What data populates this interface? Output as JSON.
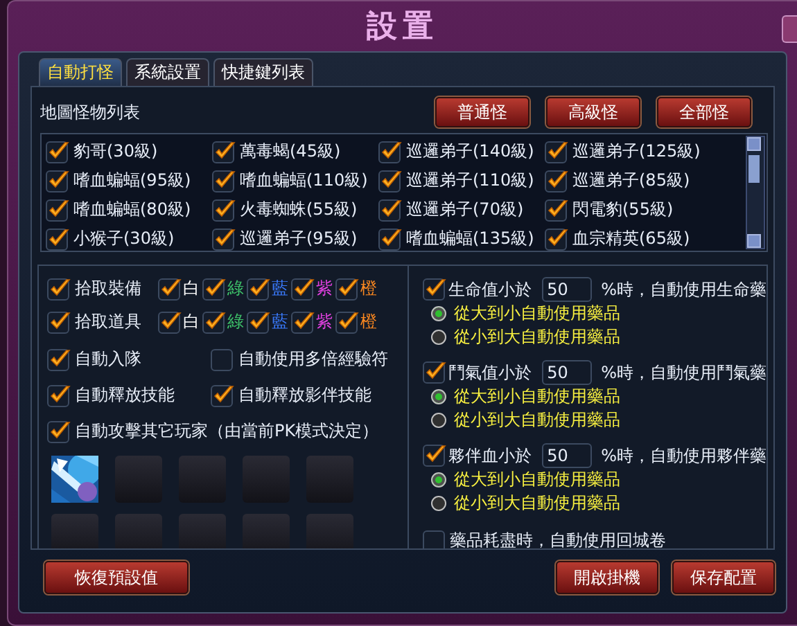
{
  "window": {
    "title": "設置"
  },
  "tabs": [
    {
      "label": "自動打怪",
      "selected": true
    },
    {
      "label": "系統設置",
      "selected": false
    },
    {
      "label": "快捷鍵列表",
      "selected": false
    }
  ],
  "monster_list": {
    "title": "地圖怪物列表",
    "buttons": [
      "普通怪",
      "高級怪",
      "全部怪"
    ],
    "items": [
      {
        "label": "豹哥(30級)",
        "checked": true
      },
      {
        "label": "萬毒蝎(45級)",
        "checked": true
      },
      {
        "label": "巡邏弟子(140級)",
        "checked": true
      },
      {
        "label": "巡邏弟子(125級)",
        "checked": true
      },
      {
        "label": "嗜血蝙蝠(95級)",
        "checked": true
      },
      {
        "label": "嗜血蝙蝠(110級)",
        "checked": true
      },
      {
        "label": "巡邏弟子(110級)",
        "checked": true
      },
      {
        "label": "巡邏弟子(85級)",
        "checked": true
      },
      {
        "label": "嗜血蝙蝠(80級)",
        "checked": true
      },
      {
        "label": "火毒蜘蛛(55級)",
        "checked": true
      },
      {
        "label": "巡邏弟子(70級)",
        "checked": true
      },
      {
        "label": "閃電豹(55級)",
        "checked": true
      },
      {
        "label": "小猴子(30級)",
        "checked": true
      },
      {
        "label": "巡邏弟子(95級)",
        "checked": true
      },
      {
        "label": "嗜血蝙蝠(135級)",
        "checked": true
      },
      {
        "label": "血宗精英(65級)",
        "checked": true
      }
    ]
  },
  "pickup": [
    {
      "label": "拾取裝備",
      "checked": true,
      "grades": [
        {
          "label": "白",
          "checked": true,
          "color": "#ffffff"
        },
        {
          "label": "綠",
          "checked": true,
          "color": "#3ec46a"
        },
        {
          "label": "藍",
          "checked": true,
          "color": "#3a7bff"
        },
        {
          "label": "紫",
          "checked": true,
          "color": "#e040e0"
        },
        {
          "label": "橙",
          "checked": true,
          "color": "#ff8a20"
        }
      ]
    },
    {
      "label": "拾取道具",
      "checked": true,
      "grades": [
        {
          "label": "白",
          "checked": true,
          "color": "#ffffff"
        },
        {
          "label": "綠",
          "checked": true,
          "color": "#3ec46a"
        },
        {
          "label": "藍",
          "checked": true,
          "color": "#3a7bff"
        },
        {
          "label": "紫",
          "checked": true,
          "color": "#e040e0"
        },
        {
          "label": "橙",
          "checked": true,
          "color": "#ff8a20"
        }
      ]
    }
  ],
  "options": [
    {
      "label": "自動入隊",
      "checked": true
    },
    {
      "label": "自動使用多倍經驗符",
      "checked": false
    },
    {
      "label": "自動釋放技能",
      "checked": true
    },
    {
      "label": "自動釋放影伴技能",
      "checked": true
    },
    {
      "label": "自動攻擊其它玩家（由當前PK模式決定）",
      "checked": true
    }
  ],
  "skill_slots": [
    {
      "kind": "picture"
    },
    {
      "kind": "empty"
    },
    {
      "kind": "empty"
    },
    {
      "kind": "empty"
    },
    {
      "kind": "empty"
    },
    {
      "kind": "empty"
    },
    {
      "kind": "empty"
    },
    {
      "kind": "empty"
    },
    {
      "kind": "empty"
    },
    {
      "kind": "empty"
    }
  ],
  "potions": [
    {
      "label": "生命值小於",
      "value": "50",
      "suffix": "%時，自動使用生命藥",
      "checked": true,
      "orders": [
        {
          "label": "從大到小自動使用藥品",
          "selected": true
        },
        {
          "label": "從小到大自動使用藥品",
          "selected": false
        }
      ]
    },
    {
      "label": "鬥氣值小於",
      "value": "50",
      "suffix": "%時，自動使用鬥氣藥",
      "checked": true,
      "orders": [
        {
          "label": "從大到小自動使用藥品",
          "selected": true
        },
        {
          "label": "從小到大自動使用藥品",
          "selected": false
        }
      ]
    },
    {
      "label": "夥伴血小於",
      "value": "50",
      "suffix": "%時，自動使用夥伴藥",
      "checked": true,
      "orders": [
        {
          "label": "從大到小自動使用藥品",
          "selected": true
        },
        {
          "label": "從小到大自動使用藥品",
          "selected": false
        }
      ]
    }
  ],
  "return_scroll": {
    "label": "藥品耗盡時，自動使用回城卷",
    "checked": false
  },
  "left_buttons": [
    "恢復預設值"
  ],
  "right_buttons": [
    "開啟掛機",
    "保存配置"
  ]
}
